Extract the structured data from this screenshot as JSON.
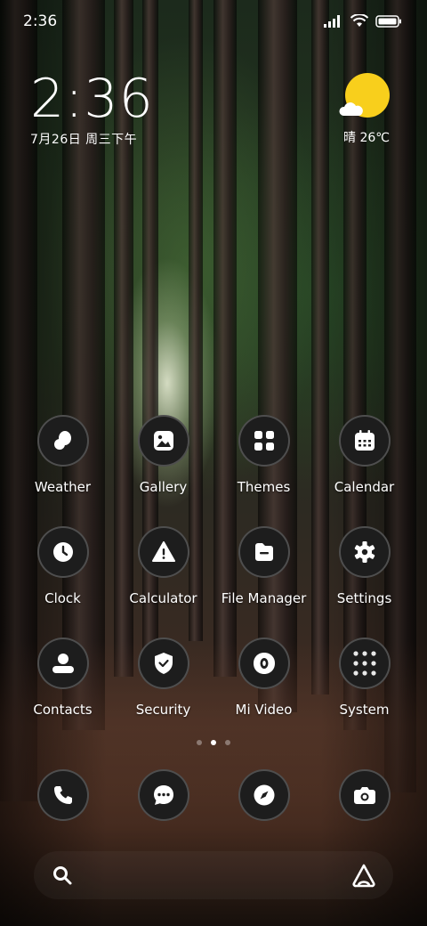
{
  "status_bar": {
    "time": "2:36",
    "icons": [
      "signal-icon",
      "wifi-icon",
      "battery-icon"
    ]
  },
  "clock_widget": {
    "time": "2:36",
    "date": "7月26日 周三下午"
  },
  "weather_widget": {
    "condition_temp": "晴 26℃",
    "icon": "sun-cloud-icon",
    "sun_color": "#f8cf1c"
  },
  "apps": [
    {
      "label": "Weather",
      "icon": "weather-drop-icon"
    },
    {
      "label": "Gallery",
      "icon": "gallery-icon"
    },
    {
      "label": "Themes",
      "icon": "themes-grid-icon"
    },
    {
      "label": "Calendar",
      "icon": "calendar-icon"
    },
    {
      "label": "Clock",
      "icon": "clock-icon"
    },
    {
      "label": "Calculator",
      "icon": "calculator-warning-icon"
    },
    {
      "label": "File Manager",
      "icon": "folder-icon"
    },
    {
      "label": "Settings",
      "icon": "gear-icon"
    },
    {
      "label": "Contacts",
      "icon": "contact-person-icon"
    },
    {
      "label": "Security",
      "icon": "shield-check-icon"
    },
    {
      "label": "Mi Video",
      "icon": "video-play-icon"
    },
    {
      "label": "System",
      "icon": "folder-grid-icon"
    }
  ],
  "page_indicator": {
    "pages": 3,
    "active": 2
  },
  "dock": [
    {
      "icon": "phone-icon"
    },
    {
      "icon": "messages-icon"
    },
    {
      "icon": "browser-compass-icon"
    },
    {
      "icon": "camera-icon"
    }
  ],
  "search_bar": {
    "left_icon": "search-icon",
    "right_icon": "assistant-icon"
  }
}
